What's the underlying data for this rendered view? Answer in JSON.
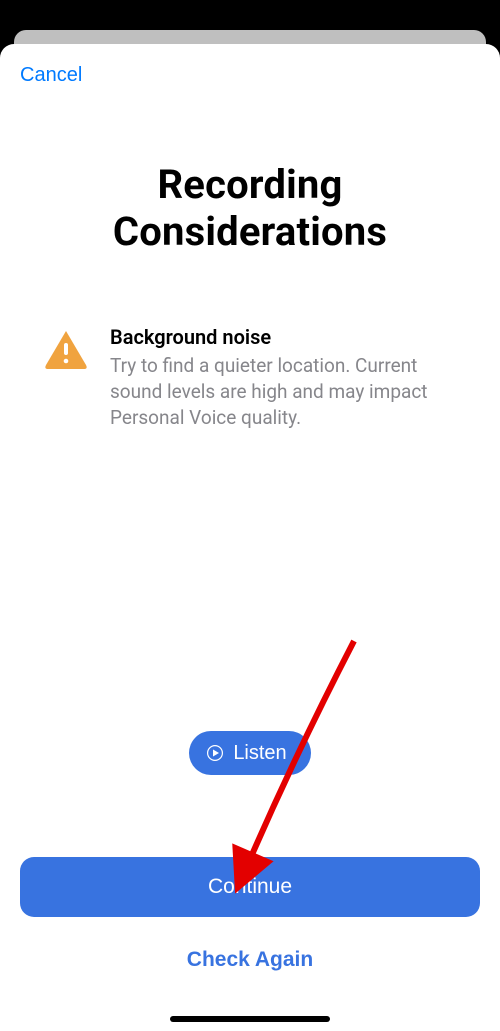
{
  "nav": {
    "cancel_label": "Cancel"
  },
  "title": "Recording Considerations",
  "consideration": {
    "heading": "Background noise",
    "body": "Try to find a quieter location. Current sound levels are high and may impact Personal Voice quality."
  },
  "listen": {
    "label": "Listen"
  },
  "footer": {
    "continue_label": "Continue",
    "check_again_label": "Check Again"
  },
  "colors": {
    "accent": "#3873e0",
    "link": "#007aff",
    "warning": "#f0a33f"
  }
}
